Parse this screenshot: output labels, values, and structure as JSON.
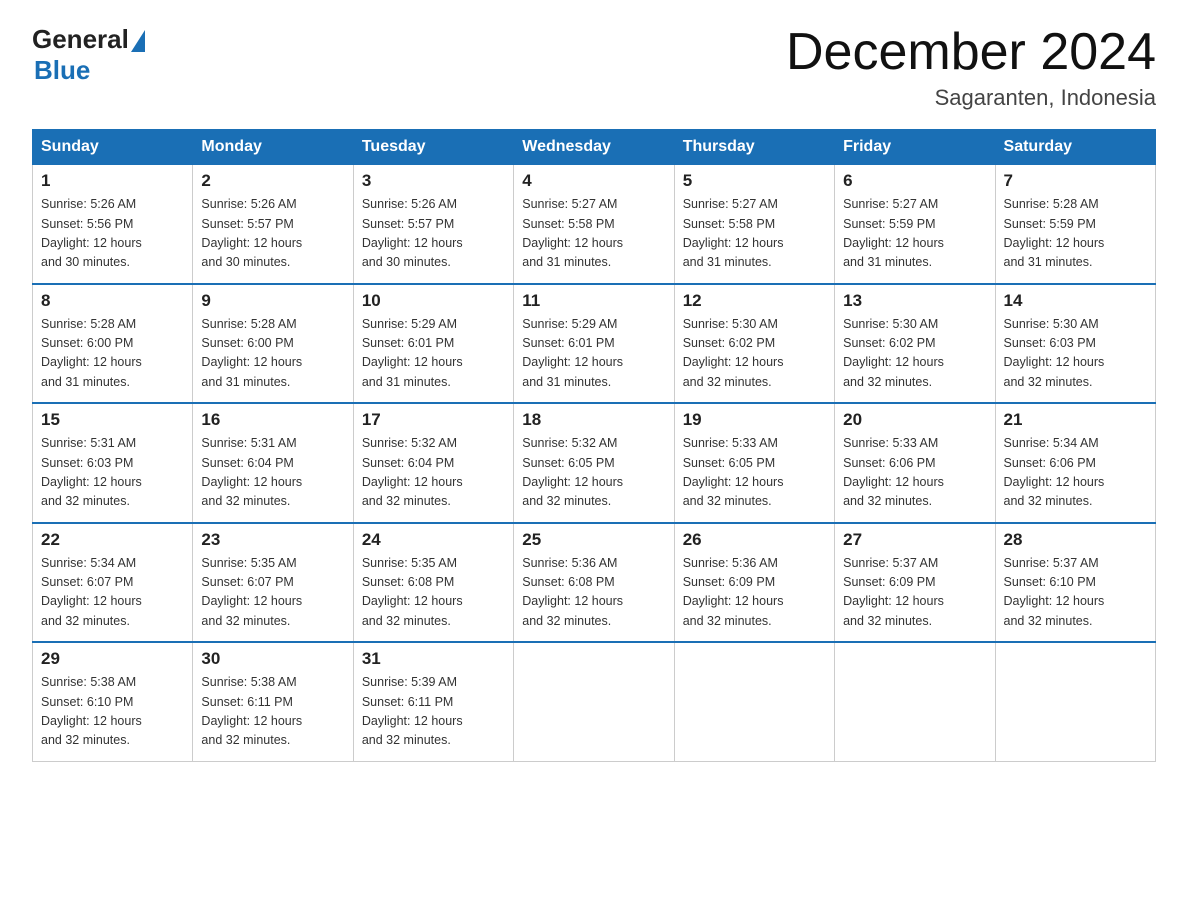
{
  "logo": {
    "general": "General",
    "blue": "Blue"
  },
  "title": "December 2024",
  "location": "Sagaranten, Indonesia",
  "days_of_week": [
    "Sunday",
    "Monday",
    "Tuesday",
    "Wednesday",
    "Thursday",
    "Friday",
    "Saturday"
  ],
  "weeks": [
    [
      {
        "day": "1",
        "info": "Sunrise: 5:26 AM\nSunset: 5:56 PM\nDaylight: 12 hours\nand 30 minutes."
      },
      {
        "day": "2",
        "info": "Sunrise: 5:26 AM\nSunset: 5:57 PM\nDaylight: 12 hours\nand 30 minutes."
      },
      {
        "day": "3",
        "info": "Sunrise: 5:26 AM\nSunset: 5:57 PM\nDaylight: 12 hours\nand 30 minutes."
      },
      {
        "day": "4",
        "info": "Sunrise: 5:27 AM\nSunset: 5:58 PM\nDaylight: 12 hours\nand 31 minutes."
      },
      {
        "day": "5",
        "info": "Sunrise: 5:27 AM\nSunset: 5:58 PM\nDaylight: 12 hours\nand 31 minutes."
      },
      {
        "day": "6",
        "info": "Sunrise: 5:27 AM\nSunset: 5:59 PM\nDaylight: 12 hours\nand 31 minutes."
      },
      {
        "day": "7",
        "info": "Sunrise: 5:28 AM\nSunset: 5:59 PM\nDaylight: 12 hours\nand 31 minutes."
      }
    ],
    [
      {
        "day": "8",
        "info": "Sunrise: 5:28 AM\nSunset: 6:00 PM\nDaylight: 12 hours\nand 31 minutes."
      },
      {
        "day": "9",
        "info": "Sunrise: 5:28 AM\nSunset: 6:00 PM\nDaylight: 12 hours\nand 31 minutes."
      },
      {
        "day": "10",
        "info": "Sunrise: 5:29 AM\nSunset: 6:01 PM\nDaylight: 12 hours\nand 31 minutes."
      },
      {
        "day": "11",
        "info": "Sunrise: 5:29 AM\nSunset: 6:01 PM\nDaylight: 12 hours\nand 31 minutes."
      },
      {
        "day": "12",
        "info": "Sunrise: 5:30 AM\nSunset: 6:02 PM\nDaylight: 12 hours\nand 32 minutes."
      },
      {
        "day": "13",
        "info": "Sunrise: 5:30 AM\nSunset: 6:02 PM\nDaylight: 12 hours\nand 32 minutes."
      },
      {
        "day": "14",
        "info": "Sunrise: 5:30 AM\nSunset: 6:03 PM\nDaylight: 12 hours\nand 32 minutes."
      }
    ],
    [
      {
        "day": "15",
        "info": "Sunrise: 5:31 AM\nSunset: 6:03 PM\nDaylight: 12 hours\nand 32 minutes."
      },
      {
        "day": "16",
        "info": "Sunrise: 5:31 AM\nSunset: 6:04 PM\nDaylight: 12 hours\nand 32 minutes."
      },
      {
        "day": "17",
        "info": "Sunrise: 5:32 AM\nSunset: 6:04 PM\nDaylight: 12 hours\nand 32 minutes."
      },
      {
        "day": "18",
        "info": "Sunrise: 5:32 AM\nSunset: 6:05 PM\nDaylight: 12 hours\nand 32 minutes."
      },
      {
        "day": "19",
        "info": "Sunrise: 5:33 AM\nSunset: 6:05 PM\nDaylight: 12 hours\nand 32 minutes."
      },
      {
        "day": "20",
        "info": "Sunrise: 5:33 AM\nSunset: 6:06 PM\nDaylight: 12 hours\nand 32 minutes."
      },
      {
        "day": "21",
        "info": "Sunrise: 5:34 AM\nSunset: 6:06 PM\nDaylight: 12 hours\nand 32 minutes."
      }
    ],
    [
      {
        "day": "22",
        "info": "Sunrise: 5:34 AM\nSunset: 6:07 PM\nDaylight: 12 hours\nand 32 minutes."
      },
      {
        "day": "23",
        "info": "Sunrise: 5:35 AM\nSunset: 6:07 PM\nDaylight: 12 hours\nand 32 minutes."
      },
      {
        "day": "24",
        "info": "Sunrise: 5:35 AM\nSunset: 6:08 PM\nDaylight: 12 hours\nand 32 minutes."
      },
      {
        "day": "25",
        "info": "Sunrise: 5:36 AM\nSunset: 6:08 PM\nDaylight: 12 hours\nand 32 minutes."
      },
      {
        "day": "26",
        "info": "Sunrise: 5:36 AM\nSunset: 6:09 PM\nDaylight: 12 hours\nand 32 minutes."
      },
      {
        "day": "27",
        "info": "Sunrise: 5:37 AM\nSunset: 6:09 PM\nDaylight: 12 hours\nand 32 minutes."
      },
      {
        "day": "28",
        "info": "Sunrise: 5:37 AM\nSunset: 6:10 PM\nDaylight: 12 hours\nand 32 minutes."
      }
    ],
    [
      {
        "day": "29",
        "info": "Sunrise: 5:38 AM\nSunset: 6:10 PM\nDaylight: 12 hours\nand 32 minutes."
      },
      {
        "day": "30",
        "info": "Sunrise: 5:38 AM\nSunset: 6:11 PM\nDaylight: 12 hours\nand 32 minutes."
      },
      {
        "day": "31",
        "info": "Sunrise: 5:39 AM\nSunset: 6:11 PM\nDaylight: 12 hours\nand 32 minutes."
      },
      {
        "day": "",
        "info": ""
      },
      {
        "day": "",
        "info": ""
      },
      {
        "day": "",
        "info": ""
      },
      {
        "day": "",
        "info": ""
      }
    ]
  ]
}
